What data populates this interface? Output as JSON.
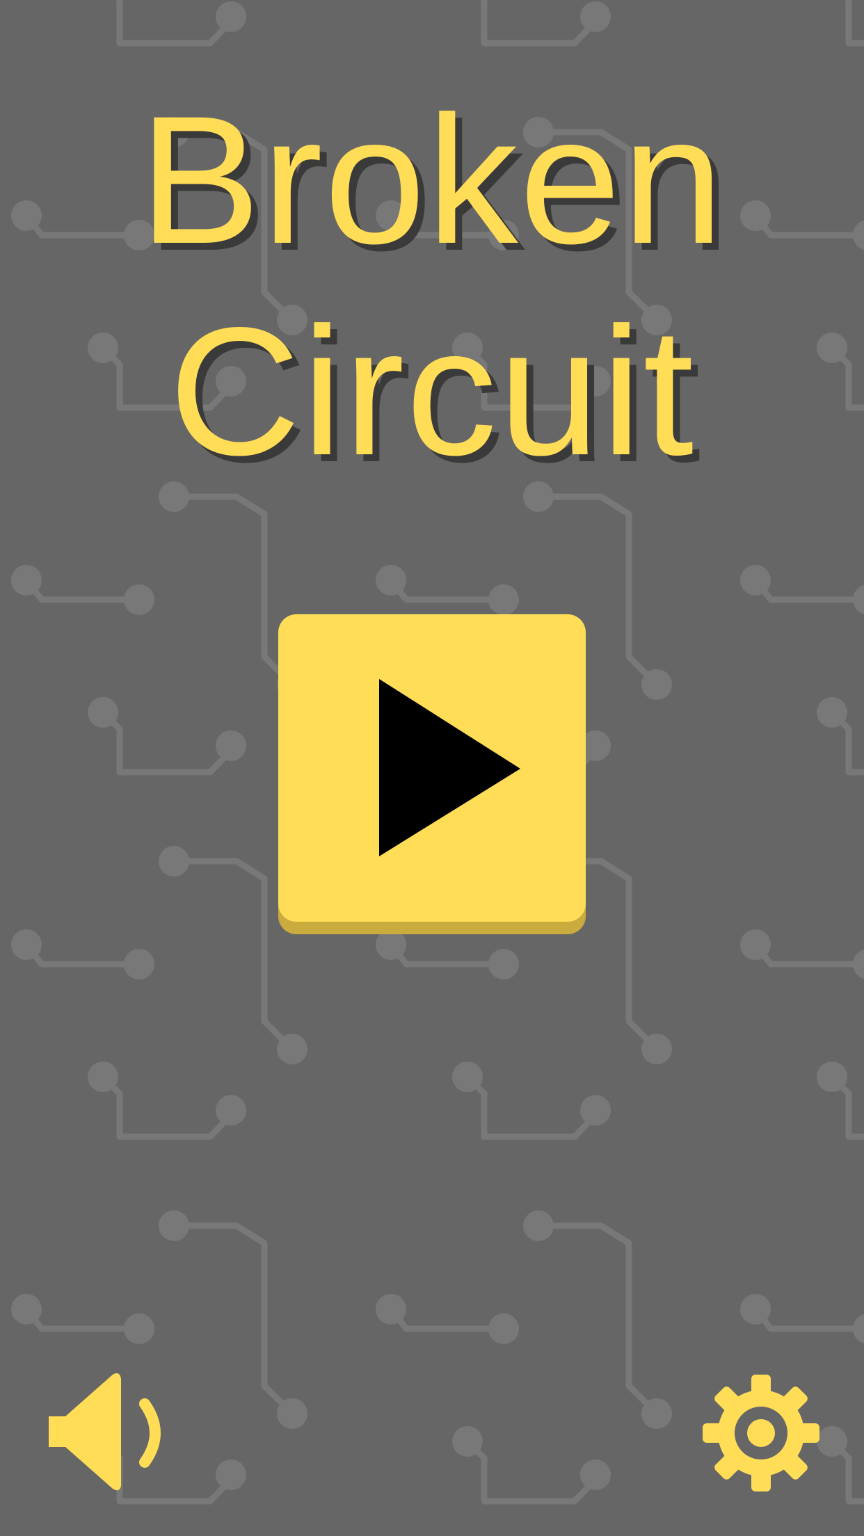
{
  "title": {
    "line1": "Broken",
    "line2": "Circuit"
  },
  "colors": {
    "background": "#666666",
    "accent": "#ffdd57",
    "accent_shadow": "#c9ab3e",
    "title_shadow": "#3a3a3a",
    "circuit_trace": "#787878",
    "play_glyph": "#000000"
  },
  "buttons": {
    "play": {
      "icon": "play-icon"
    },
    "sound": {
      "icon": "speaker-icon"
    },
    "settings": {
      "icon": "gear-icon"
    }
  }
}
